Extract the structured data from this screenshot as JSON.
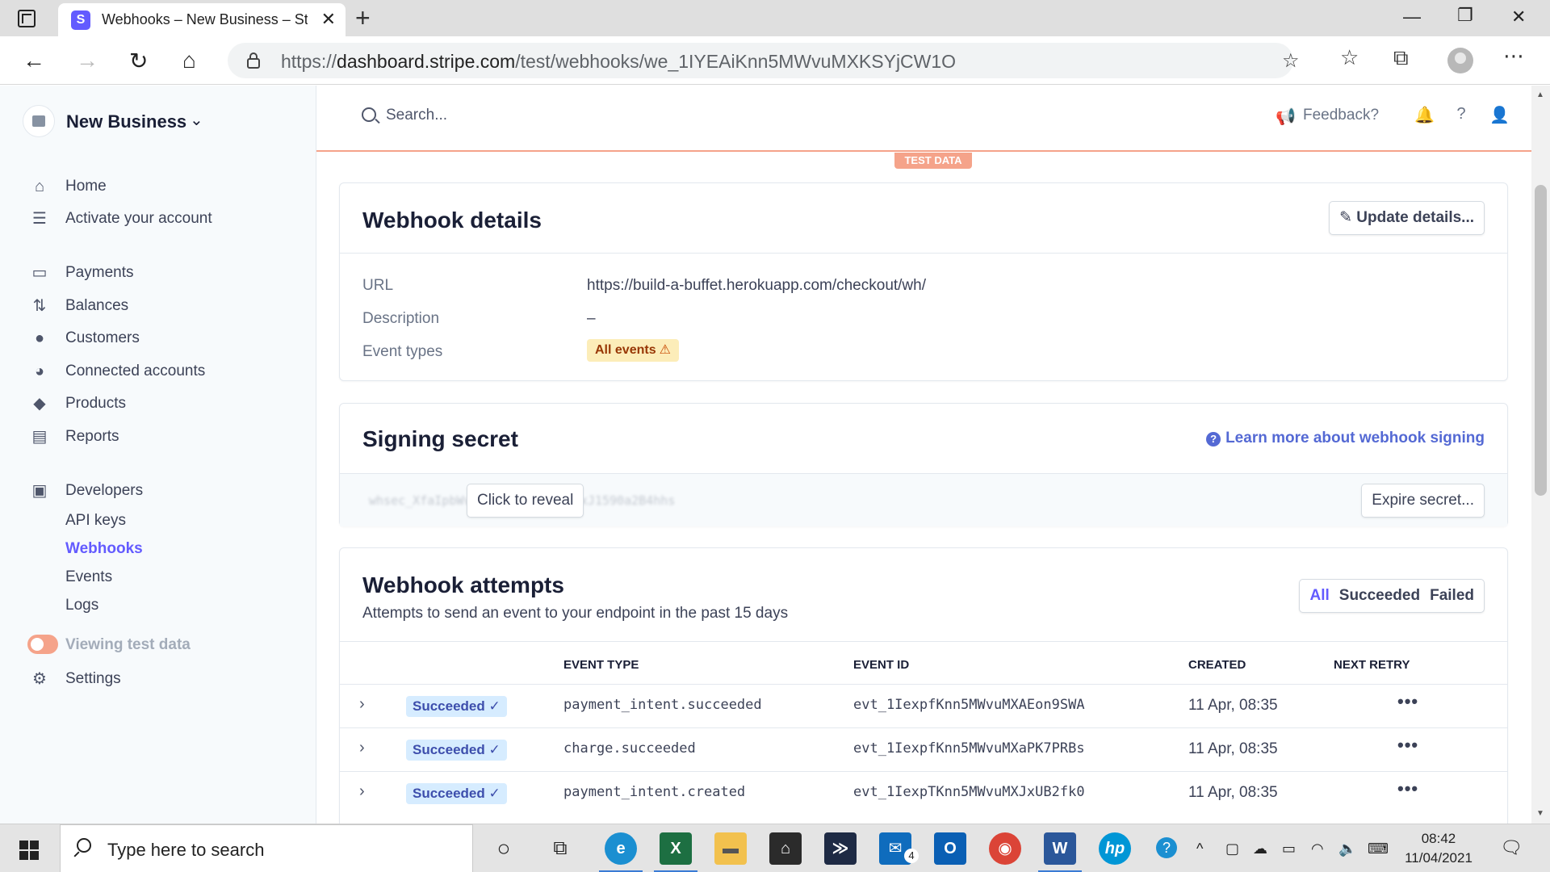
{
  "browser": {
    "tab_title": "Webhooks – New Business – Stripe",
    "new_tab": "+",
    "url_prefix": "https://",
    "url_host": "dashboard.stripe.com",
    "url_path": "/test/webhooks/we_1IYEAiKnn5MWvuMXKSYjCW1O"
  },
  "sidebar": {
    "business_name": "New Business",
    "items": [
      {
        "label": "Home",
        "icon": "home-icon"
      },
      {
        "label": "Activate your account",
        "icon": "activate-icon"
      },
      {
        "label": "Payments",
        "icon": "payments-icon"
      },
      {
        "label": "Balances",
        "icon": "balances-icon"
      },
      {
        "label": "Customers",
        "icon": "customers-icon"
      },
      {
        "label": "Connected accounts",
        "icon": "connected-accounts-icon"
      },
      {
        "label": "Products",
        "icon": "products-icon"
      },
      {
        "label": "Reports",
        "icon": "reports-icon"
      },
      {
        "label": "Developers",
        "icon": "developers-icon"
      }
    ],
    "developer_sub": [
      "API keys",
      "Webhooks",
      "Events",
      "Logs"
    ],
    "active_sub": "Webhooks",
    "test_toggle_label": "Viewing test data",
    "settings_label": "Settings"
  },
  "header": {
    "search_placeholder": "Search...",
    "feedback_label": "Feedback?",
    "test_badge": "TEST DATA"
  },
  "webhook_details": {
    "title": "Webhook details",
    "update_button": "Update details...",
    "fields": [
      {
        "key": "URL",
        "value": "https://build-a-buffet.herokuapp.com/checkout/wh/"
      },
      {
        "key": "Description",
        "value": "–"
      },
      {
        "key": "Event types",
        "value": "All events"
      }
    ]
  },
  "signing_secret": {
    "title": "Signing secret",
    "learn_more": "Learn more about webhook signing",
    "reveal_button": "Click to reveal",
    "expire_button": "Expire secret...",
    "masked_secret": "whsec_XfaIpbWv3HjP8dKwR2aQ1s9xJ1590a2B4hhs"
  },
  "webhook_attempts": {
    "title": "Webhook attempts",
    "subtitle": "Attempts to send an event to your endpoint in the past 15 days",
    "filters": [
      "All",
      "Succeeded",
      "Failed"
    ],
    "active_filter": "All",
    "columns": [
      "EVENT TYPE",
      "EVENT ID",
      "CREATED",
      "NEXT RETRY"
    ],
    "rows": [
      {
        "status": "Succeeded",
        "event_type": "payment_intent.succeeded",
        "event_id": "evt_1IexpfKnn5MWvuMXAEon9SWA",
        "created": "11 Apr, 08:35"
      },
      {
        "status": "Succeeded",
        "event_type": "charge.succeeded",
        "event_id": "evt_1IexpfKnn5MWvuMXaPK7PRBs",
        "created": "11 Apr, 08:35"
      },
      {
        "status": "Succeeded",
        "event_type": "payment_intent.created",
        "event_id": "evt_1IexpTKnn5MWvuMXJxUB2fk0",
        "created": "11 Apr, 08:35"
      }
    ]
  },
  "taskbar": {
    "search_placeholder": "Type here to search",
    "mail_badge": "4",
    "time": "08:42",
    "date": "11/04/2021"
  },
  "colors": {
    "accent": "#635bff",
    "test_mode": "#f5a38a",
    "link": "#5469d4",
    "success_bg": "#d6ecff",
    "warning_bg": "#fcedb9"
  }
}
